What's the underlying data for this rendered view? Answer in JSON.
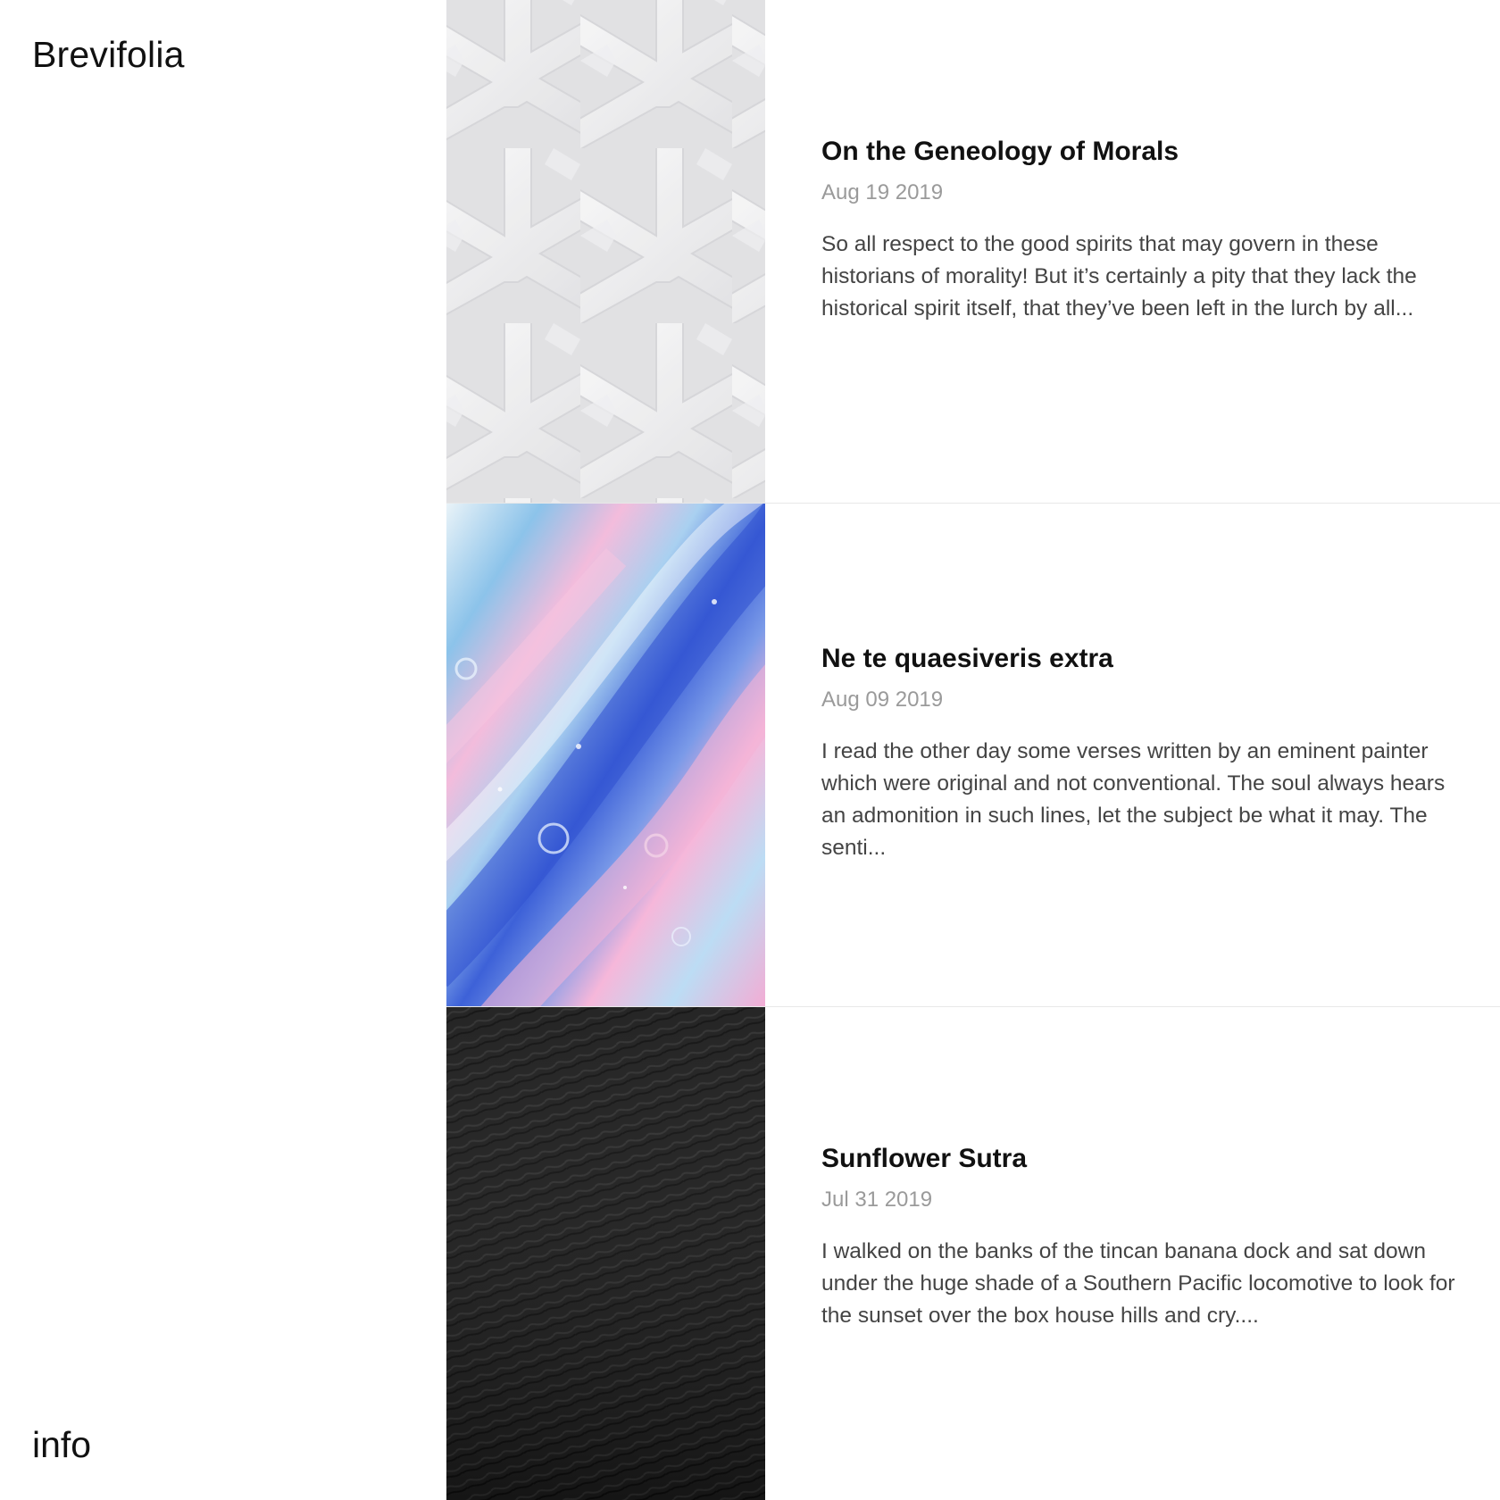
{
  "site": {
    "title": "Brevifolia",
    "info_link": "info"
  },
  "posts": [
    {
      "title": "On the Geneology of Morals",
      "date": "Aug 19 2019",
      "excerpt": "So all respect to the good spirits that may govern in these historians of morality! But it’s certainly a pity that they lack the historical spirit itself, that they’ve been left in the lurch by all...",
      "thumbnail": "white-weave-pattern"
    },
    {
      "title": "Ne te quaesiveris extra",
      "date": "Aug 09 2019",
      "excerpt": "I read the other day some verses written by an eminent painter which were original and not conventional. The soul always hears an admonition in such lines, let the subject be what it may. The senti...",
      "thumbnail": "blue-pink-marble-paint"
    },
    {
      "title": "Sunflower Sutra",
      "date": "Jul 31 2019",
      "excerpt": "I walked on the banks of the tincan banana dock and sat down under the huge shade of a Southern Pacific locomotive to look for the sunset over the box house hills and cry....",
      "thumbnail": "black-leather-texture"
    }
  ],
  "colors": {
    "background": "#ffffff",
    "title_text": "#111111",
    "date_text": "#9a9a9a",
    "excerpt_text": "#444444",
    "divider": "#e8e8e8"
  }
}
